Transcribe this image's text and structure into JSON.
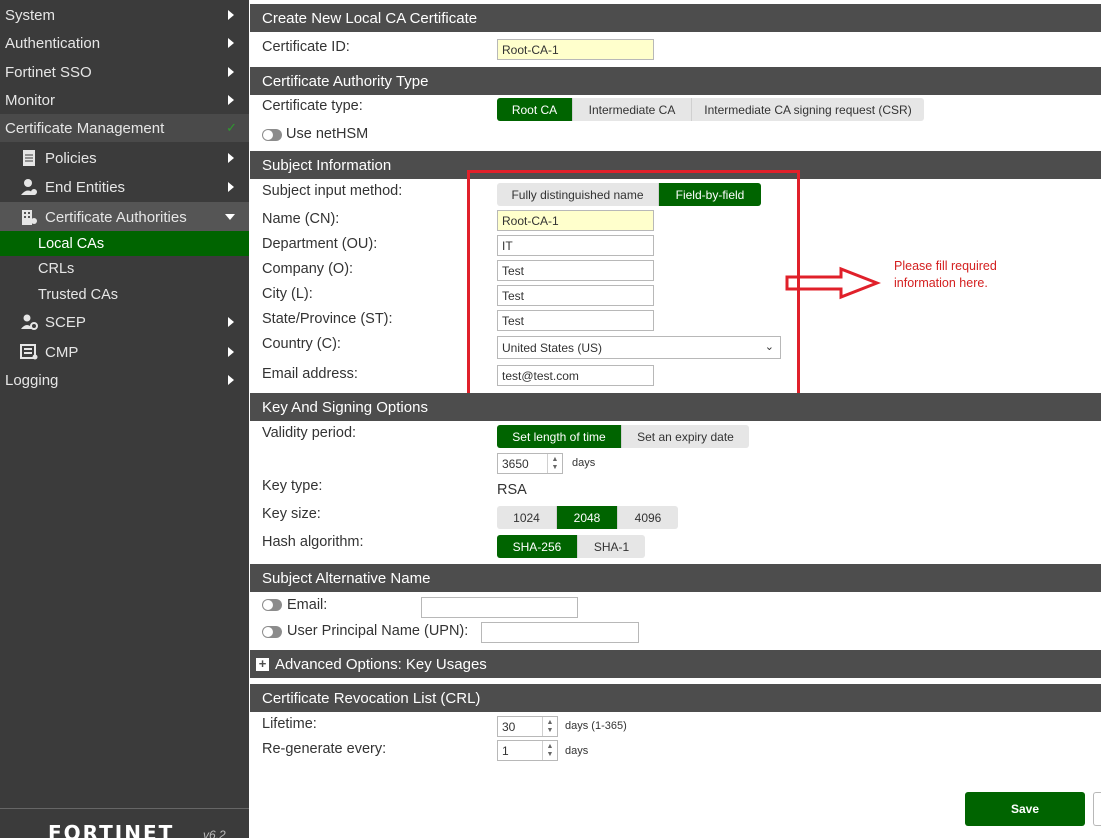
{
  "sidebar": {
    "system": "System",
    "authentication": "Authentication",
    "fortinet_sso": "Fortinet SSO",
    "monitor": "Monitor",
    "certificate_management": "Certificate Management",
    "policies": "Policies",
    "end_entities": "End Entities",
    "certificate_authorities": "Certificate Authorities",
    "local_cas": "Local CAs",
    "crls": "CRLs",
    "trusted_cas": "Trusted CAs",
    "scep": "SCEP",
    "cmp": "CMP",
    "logging": "Logging",
    "logo": "FORTINET",
    "version": "v6.2"
  },
  "form": {
    "title": "Create New Local CA Certificate",
    "cert_id_label": "Certificate ID:",
    "cert_id_value": "Root-CA-1",
    "ca_type_header": "Certificate Authority Type",
    "cert_type_label": "Certificate type:",
    "cert_type_options": [
      "Root CA",
      "Intermediate CA",
      "Intermediate CA signing request (CSR)"
    ],
    "use_nethsm": "Use netHSM",
    "subject_header": "Subject Information",
    "subject_input_label": "Subject input method:",
    "subject_input_options": [
      "Fully distinguished name",
      "Field-by-field"
    ],
    "name_label": "Name (CN):",
    "name_value": "Root-CA-1",
    "dept_label": "Department (OU):",
    "dept_value": "IT",
    "company_label": "Company (O):",
    "company_value": "Test",
    "city_label": "City (L):",
    "city_value": "Test",
    "state_label": "State/Province (ST):",
    "state_value": "Test",
    "country_label": "Country (C):",
    "country_value": "United States (US)",
    "email_label": "Email address:",
    "email_value": "test@test.com",
    "annotation": "Please fill required information here.",
    "key_header": "Key And Signing Options",
    "validity_label": "Validity period:",
    "validity_options": [
      "Set length of time",
      "Set an expiry date"
    ],
    "validity_days": "3650",
    "days_unit": "days",
    "key_type_label": "Key type:",
    "key_type_value": "RSA",
    "key_size_label": "Key size:",
    "key_size_options": [
      "1024",
      "2048",
      "4096"
    ],
    "hash_label": "Hash algorithm:",
    "hash_options": [
      "SHA-256",
      "SHA-1"
    ],
    "san_header": "Subject Alternative Name",
    "san_email_label": "Email:",
    "san_upn_label": "User Principal Name (UPN):",
    "advanced_header": "Advanced Options: Key Usages",
    "crl_header": "Certificate Revocation List (CRL)",
    "lifetime_label": "Lifetime:",
    "lifetime_value": "30",
    "lifetime_unit": "days (1-365)",
    "regen_label": "Re-generate every:",
    "regen_value": "1",
    "regen_unit": "days",
    "save_label": "Save"
  },
  "colors": {
    "accent": "#006400",
    "sidebar_bg": "#3b3b3b",
    "header_bg": "#4d4d4d",
    "annotation": "#e0202a"
  }
}
